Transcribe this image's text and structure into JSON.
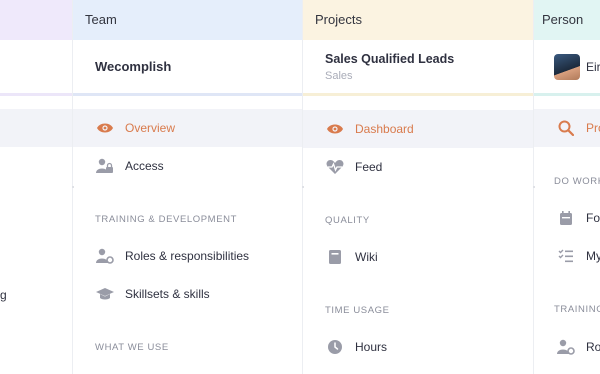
{
  "columns": {
    "team": {
      "header": "Team",
      "selected": "Wecomplish",
      "nav": [
        {
          "label": "Overview",
          "icon": "eye-icon",
          "active": true
        },
        {
          "label": "Access",
          "icon": "user-lock-icon",
          "active": false
        }
      ],
      "section_training": "TRAINING & DEVELOPMENT",
      "training_items": [
        {
          "label": "Roles & responsibilities",
          "icon": "user-gear-icon"
        },
        {
          "label": "Skillsets & skills",
          "icon": "graduation-cap-icon"
        }
      ],
      "section_what_we_use": "WHAT WE USE"
    },
    "projects": {
      "header": "Projects",
      "selected_title": "Sales Qualified Leads",
      "selected_subtitle": "Sales",
      "nav": [
        {
          "label": "Dashboard",
          "icon": "eye-icon",
          "active": true
        },
        {
          "label": "Feed",
          "icon": "heart-pulse-icon",
          "active": false
        }
      ],
      "section_quality": "QUALITY",
      "quality_items": [
        {
          "label": "Wiki",
          "icon": "book-icon"
        }
      ],
      "section_time": "TIME USAGE",
      "time_items": [
        {
          "label": "Hours",
          "icon": "clock-icon"
        }
      ]
    },
    "person": {
      "header": "Person",
      "name_partial": "Eiri",
      "nav": [
        {
          "label": "Pro",
          "icon": "magnifier-icon",
          "active": true
        }
      ],
      "section_do_work": "DO WORK",
      "work_items": [
        {
          "label": "Foc",
          "icon": "calendar-icon"
        },
        {
          "label": "My",
          "icon": "checklist-icon"
        }
      ],
      "section_training": "TRAINING",
      "training_items": [
        {
          "label": "Rol",
          "icon": "user-gear-icon"
        }
      ]
    },
    "left": {
      "partial_text": "g"
    }
  },
  "colors": {
    "accent": "#d97b4d",
    "section_text": "#8a8d9a",
    "active_bg": "#f2f3f8"
  }
}
